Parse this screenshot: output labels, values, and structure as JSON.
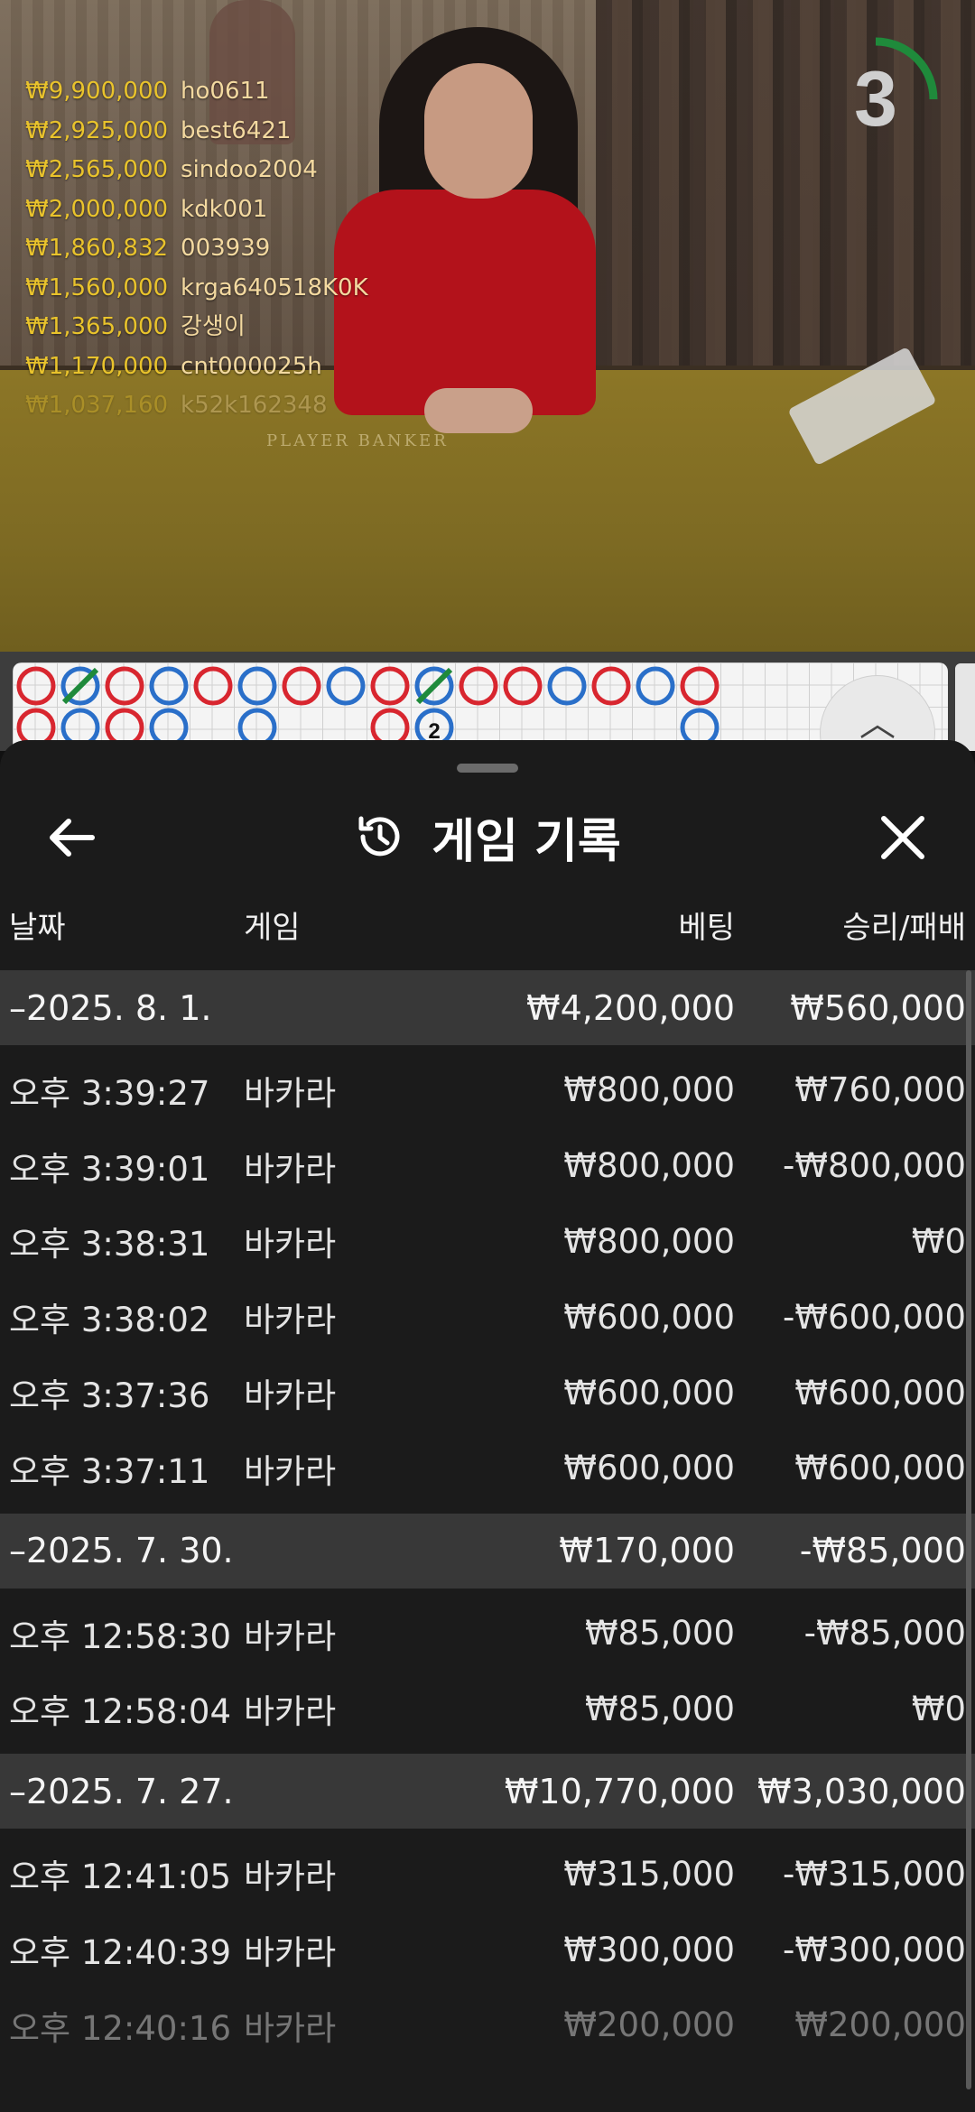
{
  "video": {
    "felt_text": "PLAYER    BANKER",
    "timer_value": "3",
    "timer_accent": "#1f8a3b",
    "leaderboard": [
      {
        "amount": "₩9,900,000",
        "user": "ho0611"
      },
      {
        "amount": "₩2,925,000",
        "user": "best6421"
      },
      {
        "amount": "₩2,565,000",
        "user": "sindoo2004"
      },
      {
        "amount": "₩2,000,000",
        "user": "kdk001"
      },
      {
        "amount": "₩1,860,832",
        "user": "003939"
      },
      {
        "amount": "₩1,560,000",
        "user": "krga640518K0K"
      },
      {
        "amount": "₩1,365,000",
        "user": "강생이"
      },
      {
        "amount": "₩1,170,000",
        "user": "cnt000025h"
      },
      {
        "amount": "₩1,037,160",
        "user": "k52k162348"
      }
    ]
  },
  "road": {
    "banker_color": "#d8262f",
    "player_color": "#2a6fc9",
    "tie_color": "#1f8a3b",
    "tie_count_label": "2",
    "toggle_icon": "chevron-up-icon"
  },
  "sheet": {
    "title": "게임 기록",
    "title_icon": "history-icon",
    "back_icon": "arrow-left-icon",
    "close_icon": "close-icon",
    "columns": {
      "date": "날짜",
      "game": "게임",
      "bet": "베팅",
      "result": "승리/패배"
    },
    "groups": [
      {
        "date": "–2025. 8. 1.",
        "bet": "₩4,200,000",
        "result": "₩560,000",
        "items": [
          {
            "time": "오후 3:39:27",
            "game": "바카라",
            "bet": "₩800,000",
            "result": "₩760,000"
          },
          {
            "time": "오후 3:39:01",
            "game": "바카라",
            "bet": "₩800,000",
            "result": "-₩800,000"
          },
          {
            "time": "오후 3:38:31",
            "game": "바카라",
            "bet": "₩800,000",
            "result": "₩0"
          },
          {
            "time": "오후 3:38:02",
            "game": "바카라",
            "bet": "₩600,000",
            "result": "-₩600,000"
          },
          {
            "time": "오후 3:37:36",
            "game": "바카라",
            "bet": "₩600,000",
            "result": "₩600,000"
          },
          {
            "time": "오후 3:37:11",
            "game": "바카라",
            "bet": "₩600,000",
            "result": "₩600,000"
          }
        ]
      },
      {
        "date": "–2025. 7. 30.",
        "bet": "₩170,000",
        "result": "-₩85,000",
        "items": [
          {
            "time": "오후 12:58:30",
            "game": "바카라",
            "bet": "₩85,000",
            "result": "-₩85,000"
          },
          {
            "time": "오후 12:58:04",
            "game": "바카라",
            "bet": "₩85,000",
            "result": "₩0"
          }
        ]
      },
      {
        "date": "–2025. 7. 27.",
        "bet": "₩10,770,000",
        "result": "₩3,030,000",
        "items": [
          {
            "time": "오후 12:41:05",
            "game": "바카라",
            "bet": "₩315,000",
            "result": "-₩315,000"
          },
          {
            "time": "오후 12:40:39",
            "game": "바카라",
            "bet": "₩300,000",
            "result": "-₩300,000"
          },
          {
            "time": "오후 12:40:16",
            "game": "바카라",
            "bet": "₩200,000",
            "result": "₩200,000"
          }
        ]
      }
    ]
  }
}
